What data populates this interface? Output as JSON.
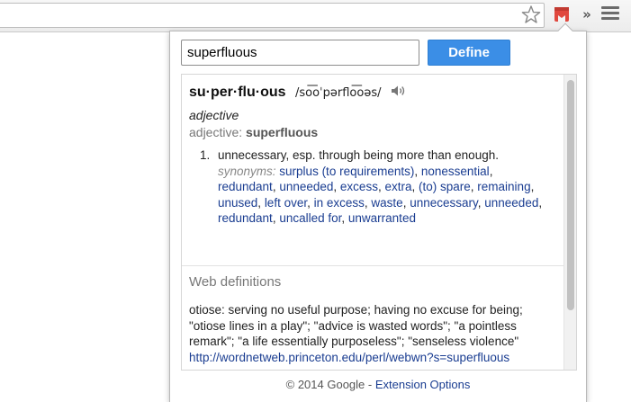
{
  "popup": {
    "search": {
      "value": "superfluous",
      "placeholder": ""
    },
    "define_label": "Define",
    "entry": {
      "headword": "su·per·flu·ous",
      "pronunciation": "/so͞oˈpərflo͞oəs/",
      "part_of_speech": "adjective",
      "form_label": "adjective:",
      "form_word": "superfluous",
      "senses": [
        {
          "number": "1.",
          "gloss": "unnecessary, esp. through being more than enough.",
          "synonyms_label": "synonyms:",
          "synonyms": [
            "surplus (to requirements)",
            "nonessential",
            "redundant",
            "unneeded",
            "excess",
            "extra",
            "(to) spare",
            "remaining",
            "unused",
            "left over",
            "in excess",
            "waste",
            "unnecessary",
            "unneeded",
            "redundant",
            "uncalled for",
            "unwarranted"
          ]
        }
      ]
    },
    "web": {
      "heading": "Web definitions",
      "definition": "otiose: serving no useful purpose; having no excuse for being; \"otiose lines in a play\"; \"advice is wasted words\"; \"a pointless remark\"; \"a life essentially purposeless\"; \"senseless violence\"",
      "source_url": "http://wordnetweb.princeton.edu/perl/webwn?s=superfluous"
    },
    "footer": {
      "copyright": "© 2014 Google -",
      "link": "Extension Options"
    }
  },
  "toolbar": {
    "icons": [
      "star-icon",
      "bookmark-ext-icon",
      "overflow-chevron-icon",
      "menu-icon"
    ],
    "chevron_glyph": "»"
  },
  "colors": {
    "define_button": "#3b8ee6",
    "link": "#1a3d91",
    "extension_icon": "#e0483e"
  }
}
